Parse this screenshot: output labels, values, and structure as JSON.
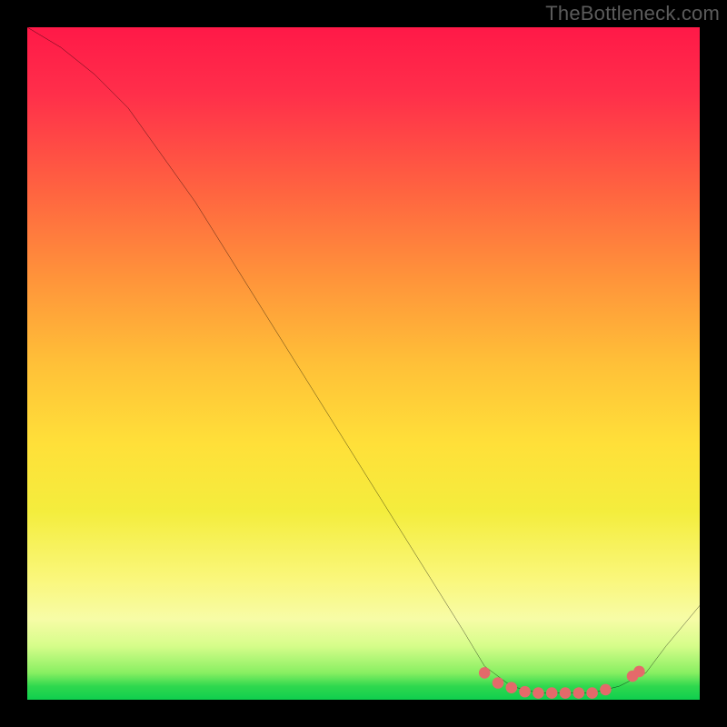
{
  "watermark": "TheBottleneck.com",
  "colors": {
    "page_bg": "#000000",
    "gradient_top": "#ff1948",
    "gradient_bottom": "#0fcf4e",
    "curve": "#000000",
    "dots": "#e46a6a"
  },
  "chart_data": {
    "type": "line",
    "title": "",
    "xlabel": "",
    "ylabel": "",
    "xlim": [
      0,
      100
    ],
    "ylim": [
      0,
      100
    ],
    "grid": false,
    "legend": false,
    "series": [
      {
        "name": "main-curve",
        "x": [
          0,
          5,
          10,
          15,
          20,
          25,
          30,
          35,
          40,
          45,
          50,
          55,
          60,
          65,
          68,
          72,
          76,
          80,
          84,
          88,
          92,
          95,
          100
        ],
        "y": [
          100,
          97,
          93,
          88,
          81,
          74,
          66,
          58,
          50,
          42,
          34,
          26,
          18,
          10,
          5,
          2,
          1,
          1,
          1,
          2,
          4,
          8,
          14
        ]
      }
    ],
    "scatter_series": [
      {
        "name": "marker-dots",
        "x": [
          68,
          70,
          72,
          74,
          76,
          78,
          80,
          82,
          84,
          86,
          90,
          91
        ],
        "y": [
          4,
          2.5,
          1.8,
          1.2,
          1,
          1,
          1,
          1,
          1,
          1.5,
          3.5,
          4.2
        ]
      }
    ]
  }
}
